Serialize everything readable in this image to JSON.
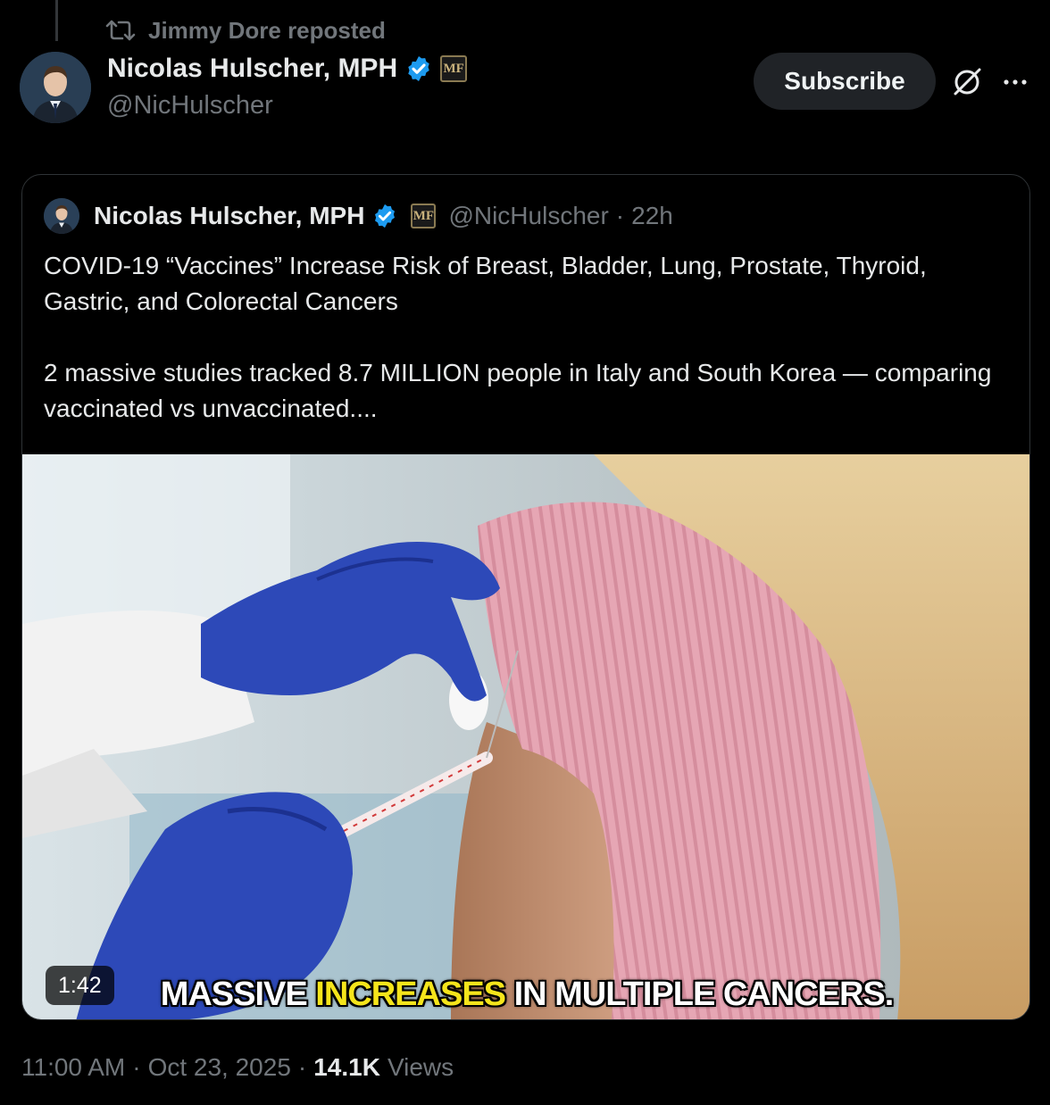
{
  "repost": {
    "label": "Jimmy Dore reposted",
    "icon": "repost-icon"
  },
  "author": {
    "display_name": "Nicolas Hulscher, MPH",
    "handle": "@NicHulscher",
    "affiliation_badge": "MF"
  },
  "actions": {
    "subscribe_label": "Subscribe",
    "more_label": "···"
  },
  "quoted_post": {
    "display_name": "Nicolas Hulscher, MPH",
    "affiliation_badge": "MF",
    "handle": "@NicHulscher",
    "separator": "·",
    "time": "22h",
    "text_line_1": "COVID-19 “Vaccines” Increase Risk of Breast, Bladder, Lung, Prostate, Thyroid, Gastric, and Colorectal Cancers",
    "text_line_2": "2 massive studies tracked 8.7 MILLION people in Italy and South Korea — comparing vaccinated vs unvaccinated....",
    "video": {
      "duration": "1:42",
      "caption_before": "MASSIVE ",
      "caption_highlight": "INCREASES",
      "caption_after": " IN MULTIPLE CANCERS."
    }
  },
  "meta": {
    "time": "11:00 AM",
    "sep1": "·",
    "date": "Oct 23, 2025",
    "sep2": "·",
    "views_count": "14.1K",
    "views_label": "Views"
  },
  "colors": {
    "background": "#000000",
    "text": "#e7e9ea",
    "muted": "#71767b",
    "verified": "#1d9bf0",
    "caption_highlight": "#f5e51b",
    "glove": "#2d49b8",
    "sweater": "#e3a1b0"
  }
}
